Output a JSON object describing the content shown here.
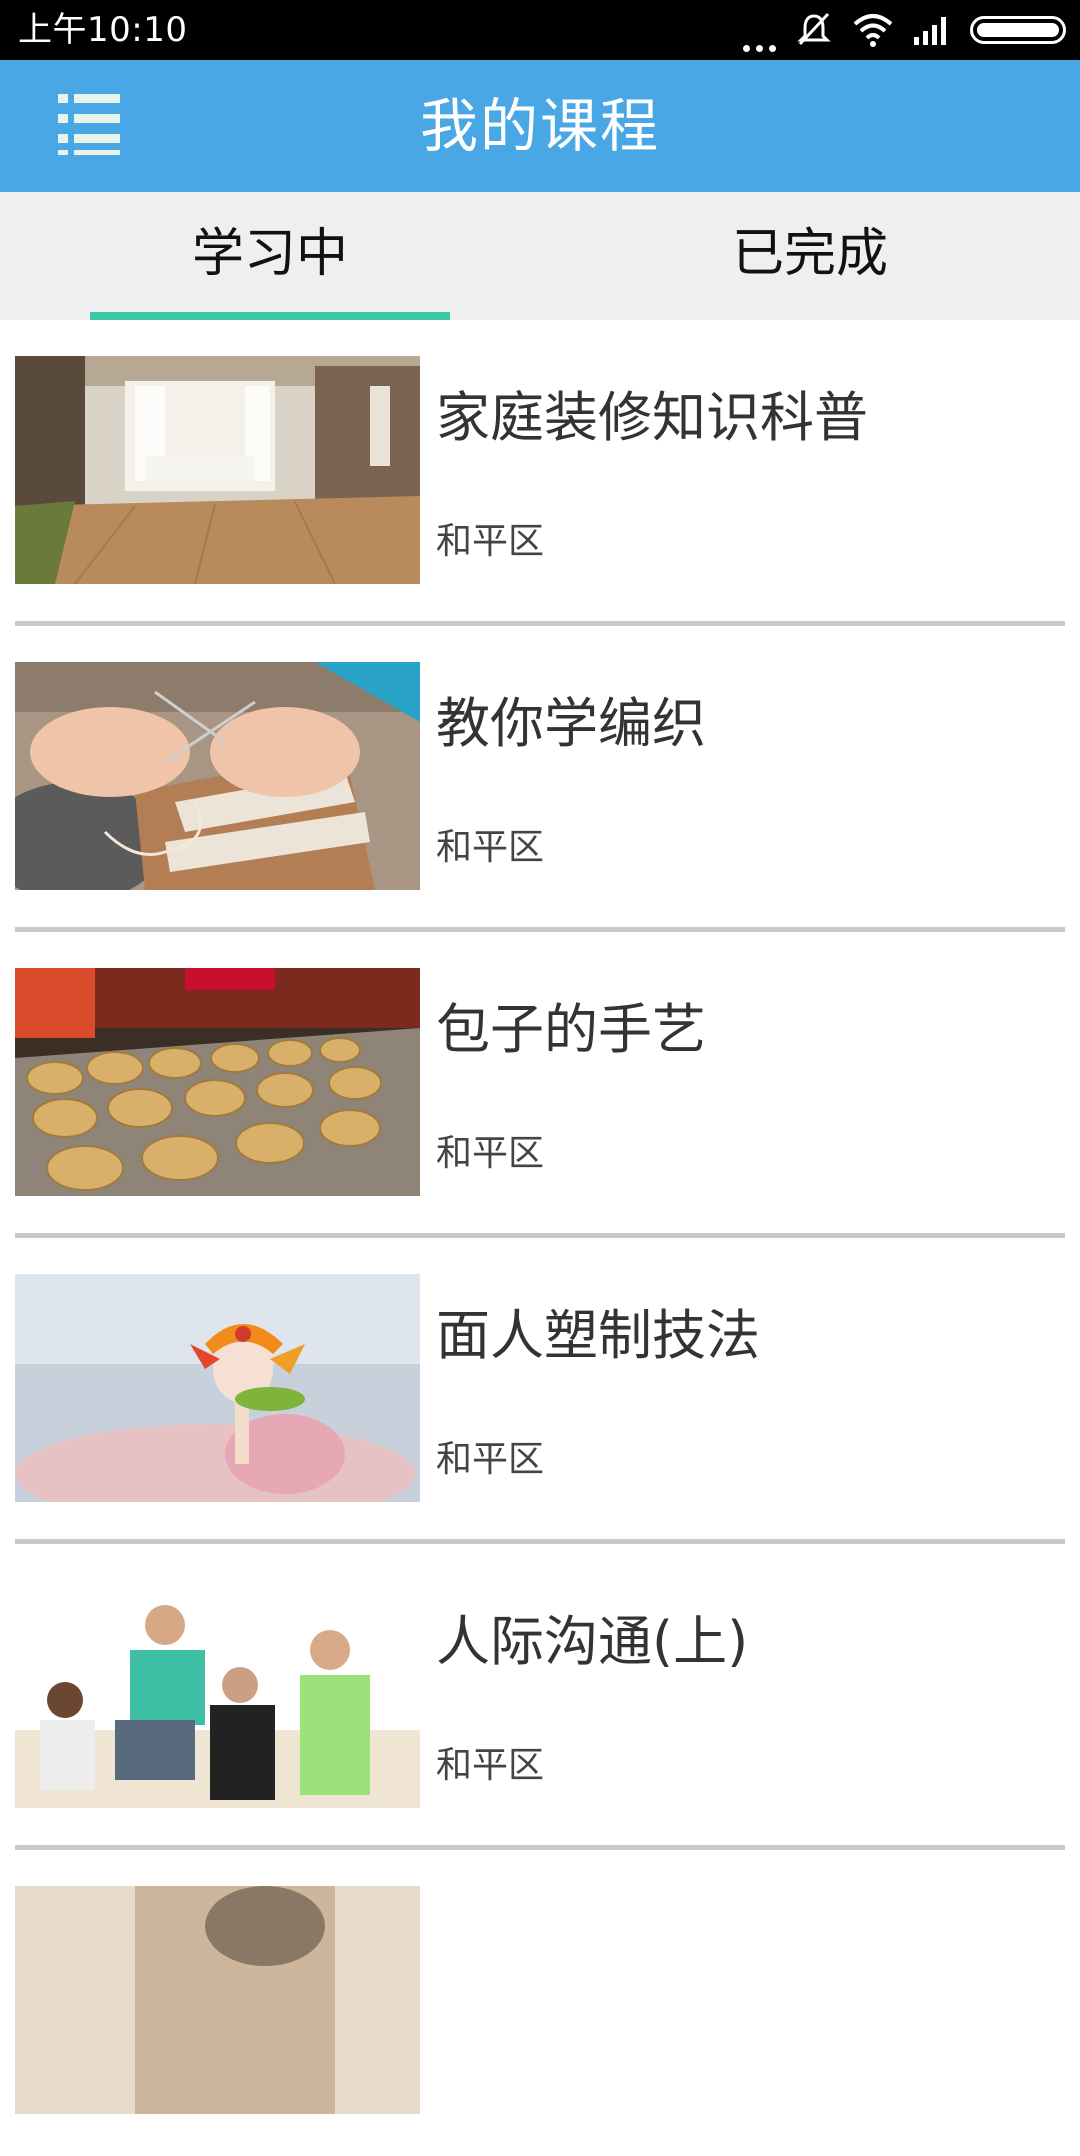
{
  "status_bar": {
    "time": "上午10:10",
    "icons": [
      "more-dots-icon",
      "mute-icon",
      "wifi-icon",
      "signal-icon",
      "battery-icon"
    ]
  },
  "app_bar": {
    "menu_icon": "menu-list-icon",
    "title": "我的课程",
    "background": "#4aa7e6"
  },
  "tabs": [
    {
      "label": "学习中",
      "selected": true
    },
    {
      "label": "已完成",
      "selected": false
    }
  ],
  "accent_color": "#3cc9a8",
  "courses": [
    {
      "title": "家庭装修知识科普",
      "area": "和平区",
      "image": "living-room-photo"
    },
    {
      "title": "教你学编织",
      "area": "和平区",
      "image": "knitting-photo"
    },
    {
      "title": "包子的手艺",
      "area": "和平区",
      "image": "steamed-buns-photo"
    },
    {
      "title": "面人塑制技法",
      "area": "和平区",
      "image": "dough-figure-photo"
    },
    {
      "title": "人际沟通(上)",
      "area": "和平区",
      "image": "people-talking-photo"
    },
    {
      "title": "",
      "area": "",
      "image": "partial-photo"
    }
  ]
}
